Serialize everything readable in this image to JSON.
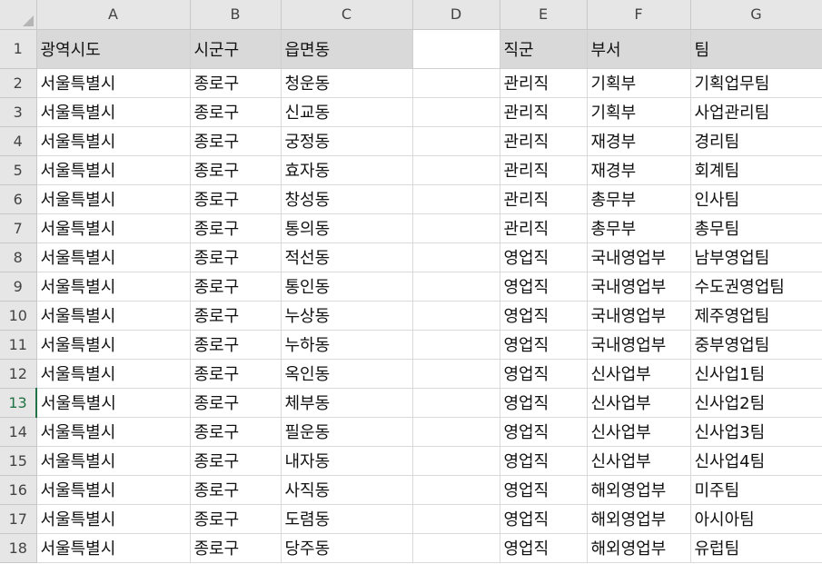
{
  "columns": [
    "A",
    "B",
    "C",
    "D",
    "E",
    "F",
    "G"
  ],
  "header_row": {
    "row_num": "1",
    "cells": [
      "광역시도",
      "시군구",
      "읍면동",
      "",
      "직군",
      "부서",
      "팀"
    ]
  },
  "rows": [
    {
      "n": "2",
      "a": "서울특별시",
      "b": "종로구",
      "c": "청운동",
      "e": "관리직",
      "f": "기획부",
      "g": "기획업무팀"
    },
    {
      "n": "3",
      "a": "서울특별시",
      "b": "종로구",
      "c": "신교동",
      "e": "관리직",
      "f": "기획부",
      "g": "사업관리팀"
    },
    {
      "n": "4",
      "a": "서울특별시",
      "b": "종로구",
      "c": "궁정동",
      "e": "관리직",
      "f": "재경부",
      "g": "경리팀"
    },
    {
      "n": "5",
      "a": "서울특별시",
      "b": "종로구",
      "c": "효자동",
      "e": "관리직",
      "f": "재경부",
      "g": "회계팀"
    },
    {
      "n": "6",
      "a": "서울특별시",
      "b": "종로구",
      "c": "창성동",
      "e": "관리직",
      "f": "총무부",
      "g": "인사팀"
    },
    {
      "n": "7",
      "a": "서울특별시",
      "b": "종로구",
      "c": "통의동",
      "e": "관리직",
      "f": "총무부",
      "g": "총무팀"
    },
    {
      "n": "8",
      "a": "서울특별시",
      "b": "종로구",
      "c": "적선동",
      "e": "영업직",
      "f": "국내영업부",
      "g": "남부영업팀"
    },
    {
      "n": "9",
      "a": "서울특별시",
      "b": "종로구",
      "c": "통인동",
      "e": "영업직",
      "f": "국내영업부",
      "g": "수도권영업팀"
    },
    {
      "n": "10",
      "a": "서울특별시",
      "b": "종로구",
      "c": "누상동",
      "e": "영업직",
      "f": "국내영업부",
      "g": "제주영업팀"
    },
    {
      "n": "11",
      "a": "서울특별시",
      "b": "종로구",
      "c": "누하동",
      "e": "영업직",
      "f": "국내영업부",
      "g": "중부영업팀"
    },
    {
      "n": "12",
      "a": "서울특별시",
      "b": "종로구",
      "c": "옥인동",
      "e": "영업직",
      "f": "신사업부",
      "g": "신사업1팀"
    },
    {
      "n": "13",
      "a": "서울특별시",
      "b": "종로구",
      "c": "체부동",
      "e": "영업직",
      "f": "신사업부",
      "g": "신사업2팀"
    },
    {
      "n": "14",
      "a": "서울특별시",
      "b": "종로구",
      "c": "필운동",
      "e": "영업직",
      "f": "신사업부",
      "g": "신사업3팀"
    },
    {
      "n": "15",
      "a": "서울특별시",
      "b": "종로구",
      "c": "내자동",
      "e": "영업직",
      "f": "신사업부",
      "g": "신사업4팀"
    },
    {
      "n": "16",
      "a": "서울특별시",
      "b": "종로구",
      "c": "사직동",
      "e": "영업직",
      "f": "해외영업부",
      "g": "미주팀"
    },
    {
      "n": "17",
      "a": "서울특별시",
      "b": "종로구",
      "c": "도렴동",
      "e": "영업직",
      "f": "해외영업부",
      "g": "아시아팀"
    },
    {
      "n": "18",
      "a": "서울특별시",
      "b": "종로구",
      "c": "당주동",
      "e": "영업직",
      "f": "해외영업부",
      "g": "유럽팀"
    }
  ],
  "selected_row": "13"
}
